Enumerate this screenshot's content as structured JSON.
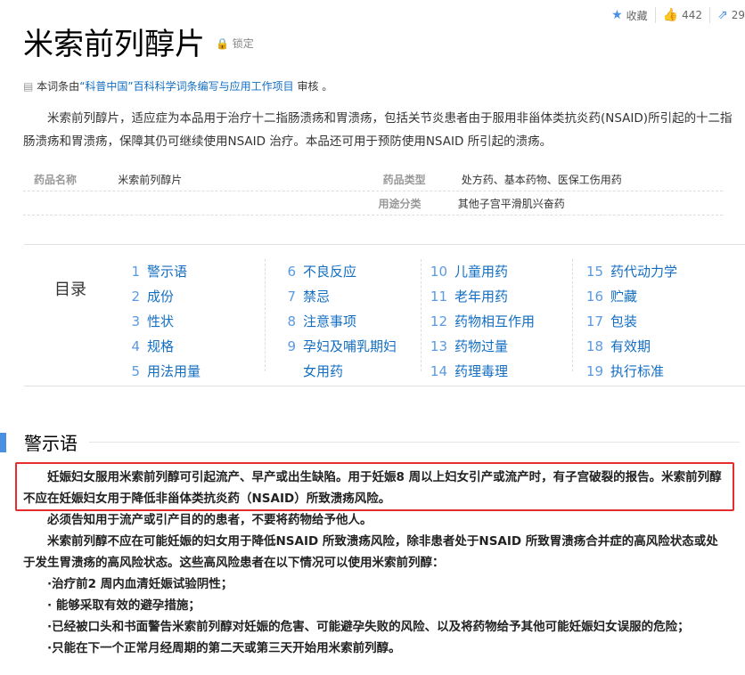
{
  "toolbar": {
    "favorite": "收藏",
    "likes": "442",
    "share": "29"
  },
  "title": "米索前列醇片",
  "lock": "锁定",
  "review": {
    "prefix": "本词条由",
    "link": "“科普中国”百科科学词条编写与应用工作项目",
    "suffix": " 审核 。"
  },
  "summary": "米索前列醇片，适应症为本品用于治疗十二指肠溃疡和胃溃疡，包括关节炎患者由于服用非甾体类抗炎药(NSAID)所引起的十二指肠溃疡和胃溃疡，保障其仍可继续使用NSAID 治疗。本品还可用于预防使用NSAID 所引起的溃疡。",
  "info": {
    "name_k": "药品名称",
    "name_v": "米索前列醇片",
    "type_k": "药品类型",
    "type_v": "处方药、基本药物、医保工伤用药",
    "use_k": "用途分类",
    "use_v": "其他子宫平滑肌兴奋药"
  },
  "toc": {
    "label": "目录",
    "cols": [
      [
        {
          "n": "1",
          "t": "警示语"
        },
        {
          "n": "2",
          "t": "成份"
        },
        {
          "n": "3",
          "t": "性状"
        },
        {
          "n": "4",
          "t": "规格"
        },
        {
          "n": "5",
          "t": "用法用量"
        }
      ],
      [
        {
          "n": "6",
          "t": "不良反应"
        },
        {
          "n": "7",
          "t": "禁忌"
        },
        {
          "n": "8",
          "t": "注意事项"
        },
        {
          "n": "9",
          "t": "孕妇及哺乳期妇"
        },
        {
          "n": "",
          "t": "女用药"
        }
      ],
      [
        {
          "n": "10",
          "t": "儿童用药"
        },
        {
          "n": "11",
          "t": "老年用药"
        },
        {
          "n": "12",
          "t": "药物相互作用"
        },
        {
          "n": "13",
          "t": "药物过量"
        },
        {
          "n": "14",
          "t": "药理毒理"
        }
      ],
      [
        {
          "n": "15",
          "t": "药代动力学"
        },
        {
          "n": "16",
          "t": "贮藏"
        },
        {
          "n": "17",
          "t": "包装"
        },
        {
          "n": "18",
          "t": "有效期"
        },
        {
          "n": "19",
          "t": "执行标准"
        }
      ]
    ]
  },
  "section": {
    "heading": "警示语",
    "p1": "妊娠妇女服用米索前列醇可引起流产、早产或出生缺陷。用于妊娠8 周以上妇女引产或流产时，有子宫破裂的报告。米索前列醇不应在妊娠妇女用于降低非甾体类抗炎药（NSAID）所致溃疡风险。",
    "p2": "必须告知用于流产或引产目的的患者，不要将药物给予他人。",
    "p3": "米索前列醇不应在可能妊娠的妇女用于降低NSAID 所致溃疡风险，除非患者处于NSAID 所致胃溃疡合并症的高风险状态或处于发生胃溃疡的高风险状态。这些高风险患者在以下情况可以使用米索前列醇：",
    "l1": "·治疗前2 周内血清妊娠试验阴性；",
    "l2": "· 能够采取有效的避孕措施；",
    "l3": "·已经被口头和书面警告米索前列醇对妊娠的危害、可能避孕失败的风险、以及将药物给予其他可能妊娠妇女误服的危险；",
    "l4": "·只能在下一个正常月经周期的第二天或第三天开始用米索前列醇。"
  }
}
